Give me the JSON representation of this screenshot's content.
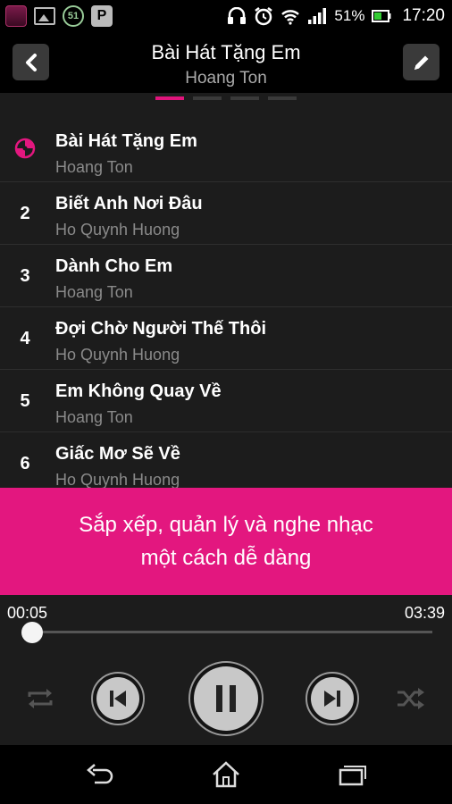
{
  "status_bar": {
    "icons_left": [
      "app-icon",
      "image-icon",
      "badge-51-icon",
      "p-app-icon"
    ],
    "badge_text": "51",
    "p_text": "P",
    "battery_percent": "51%",
    "time": "17:20"
  },
  "header": {
    "title": "Bài Hát Tặng Em",
    "subtitle": "Hoang Ton"
  },
  "pager": {
    "count": 4,
    "active_index": 0
  },
  "tracks": [
    {
      "number": "",
      "title": "Bài Hát Tặng Em",
      "artist": "Hoang Ton",
      "playing": true
    },
    {
      "number": "2",
      "title": "Biết Anh Nơi Đâu",
      "artist": "Ho Quynh Huong",
      "playing": false
    },
    {
      "number": "3",
      "title": "Dành Cho Em",
      "artist": "Hoang Ton",
      "playing": false
    },
    {
      "number": "4",
      "title": "Đợi Chờ Người Thế Thôi",
      "artist": "Ho Quynh Huong",
      "playing": false
    },
    {
      "number": "5",
      "title": "Em Không Quay Về",
      "artist": "Hoang Ton",
      "playing": false
    },
    {
      "number": "6",
      "title": "Giấc Mơ Sẽ Về",
      "artist": "Ho Quynh Huong",
      "playing": false
    }
  ],
  "banner": {
    "line1": "Sắp xếp, quản lý và nghe nhạc",
    "line2": "một cách dễ dàng"
  },
  "player": {
    "current_time": "00:05",
    "total_time": "03:39",
    "progress": 0.0228
  },
  "colors": {
    "accent": "#e3177f",
    "background": "#1c1c1c"
  }
}
